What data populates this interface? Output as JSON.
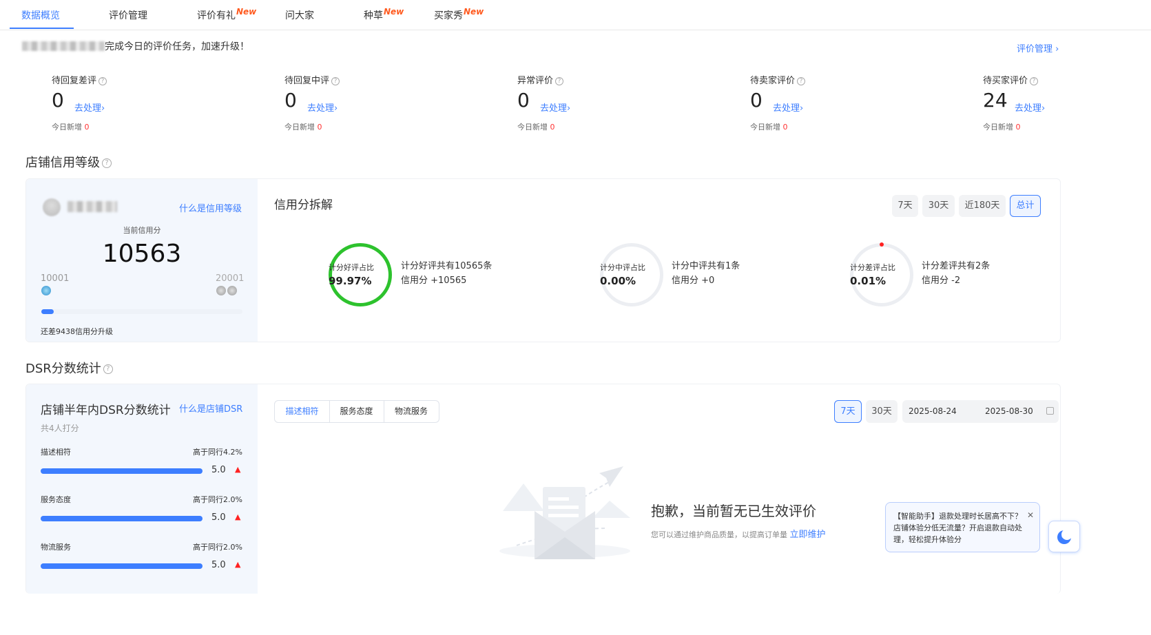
{
  "tabs": [
    {
      "label": "数据概览",
      "new": ""
    },
    {
      "label": "评价管理",
      "new": ""
    },
    {
      "label": "评价有礼",
      "new": "New"
    },
    {
      "label": "问大家",
      "new": ""
    },
    {
      "label": "种草",
      "new": "New"
    },
    {
      "label": "买家秀",
      "new": "New"
    }
  ],
  "banner": {
    "text": "完成今日的评价任务，加速升级！",
    "link": "评价管理 ›"
  },
  "metrics": [
    {
      "label": "待回复差评",
      "value": "0",
      "go": "去处理›",
      "today": "今日新增",
      "today_val": "0"
    },
    {
      "label": "待回复中评",
      "value": "0",
      "go": "去处理›",
      "today": "今日新增",
      "today_val": "0"
    },
    {
      "label": "异常评价",
      "value": "0",
      "go": "去处理›",
      "today": "今日新增",
      "today_val": "0"
    },
    {
      "label": "待卖家评价",
      "value": "0",
      "go": "去处理›",
      "today": "今日新增",
      "today_val": "0"
    },
    {
      "label": "待买家评价",
      "value": "24",
      "go": "去处理›",
      "today": "今日新增",
      "today_val": "0"
    }
  ],
  "credit": {
    "section_title": "店铺信用等级",
    "what_link": "什么是信用等级",
    "current_label": "当前信用分",
    "score": "10563",
    "range_min": "10001",
    "range_max": "20001",
    "progress": 0.06,
    "upgrade_text": "还差9438信用分升级",
    "breakdown_title": "信用分拆解",
    "periods": [
      "7天",
      "30天",
      "近180天",
      "总计"
    ],
    "active_period": "总计",
    "rings": [
      {
        "label": "计分好评占比",
        "percent": "99.97%",
        "fraction": 0.9997,
        "color": "#2dc22d",
        "line1": "计分好评共有10565条",
        "line2": "信用分 +10565"
      },
      {
        "label": "计分中评占比",
        "percent": "0.00%",
        "fraction": 0,
        "color": "#2dc22d",
        "line1": "计分中评共有1条",
        "line2": "信用分 +0"
      },
      {
        "label": "计分差评占比",
        "percent": "0.01%",
        "fraction": 0.0001,
        "color": "#f22",
        "line1": "计分差评共有2条",
        "line2": "信用分 -2"
      }
    ]
  },
  "dsr": {
    "section_title": "DSR分数统计",
    "panel_title": "店铺半年内DSR分数统计",
    "what_link": "什么是店铺DSR",
    "count_text": "共4人打分",
    "items": [
      {
        "name": "描述相符",
        "compare": "高于同行4.2%",
        "score": "5.0",
        "fraction": 1.0
      },
      {
        "name": "服务态度",
        "compare": "高于同行2.0%",
        "score": "5.0",
        "fraction": 1.0
      },
      {
        "name": "物流服务",
        "compare": "高于同行2.0%",
        "score": "5.0",
        "fraction": 1.0
      }
    ],
    "seg_tabs": [
      "描述相符",
      "服务态度",
      "物流服务"
    ],
    "periods": [
      "7天",
      "30天"
    ],
    "date_start": "2025-08-24",
    "date_end": "2025-08-30",
    "empty_title": "抱歉，当前暂无已生效评价",
    "empty_desc": "您可以通过维护商品质量，以提高订单量",
    "empty_link": "立即维护"
  },
  "assistant": {
    "text": "【智能助手】退款处理时长居高不下？店铺体验分低无流量？开启退款自动处理，轻松提升体验分",
    "close": "✕"
  },
  "colors": {
    "accent": "#3d7eff",
    "good": "#2dc22d",
    "bad": "#ff2222",
    "new": "#ff5a1f"
  }
}
